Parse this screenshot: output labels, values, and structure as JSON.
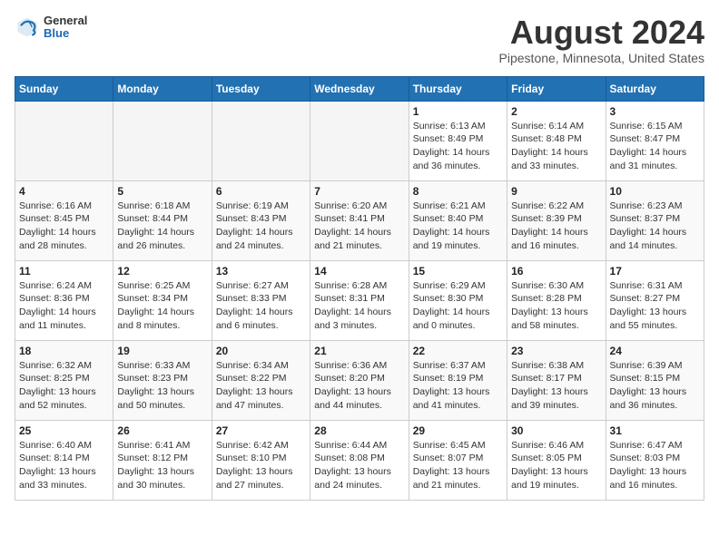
{
  "header": {
    "logo_general": "General",
    "logo_blue": "Blue",
    "month_title": "August 2024",
    "location": "Pipestone, Minnesota, United States"
  },
  "days_of_week": [
    "Sunday",
    "Monday",
    "Tuesday",
    "Wednesday",
    "Thursday",
    "Friday",
    "Saturday"
  ],
  "weeks": [
    [
      {
        "day": "",
        "info": ""
      },
      {
        "day": "",
        "info": ""
      },
      {
        "day": "",
        "info": ""
      },
      {
        "day": "",
        "info": ""
      },
      {
        "day": "1",
        "info": "Sunrise: 6:13 AM\nSunset: 8:49 PM\nDaylight: 14 hours\nand 36 minutes."
      },
      {
        "day": "2",
        "info": "Sunrise: 6:14 AM\nSunset: 8:48 PM\nDaylight: 14 hours\nand 33 minutes."
      },
      {
        "day": "3",
        "info": "Sunrise: 6:15 AM\nSunset: 8:47 PM\nDaylight: 14 hours\nand 31 minutes."
      }
    ],
    [
      {
        "day": "4",
        "info": "Sunrise: 6:16 AM\nSunset: 8:45 PM\nDaylight: 14 hours\nand 28 minutes."
      },
      {
        "day": "5",
        "info": "Sunrise: 6:18 AM\nSunset: 8:44 PM\nDaylight: 14 hours\nand 26 minutes."
      },
      {
        "day": "6",
        "info": "Sunrise: 6:19 AM\nSunset: 8:43 PM\nDaylight: 14 hours\nand 24 minutes."
      },
      {
        "day": "7",
        "info": "Sunrise: 6:20 AM\nSunset: 8:41 PM\nDaylight: 14 hours\nand 21 minutes."
      },
      {
        "day": "8",
        "info": "Sunrise: 6:21 AM\nSunset: 8:40 PM\nDaylight: 14 hours\nand 19 minutes."
      },
      {
        "day": "9",
        "info": "Sunrise: 6:22 AM\nSunset: 8:39 PM\nDaylight: 14 hours\nand 16 minutes."
      },
      {
        "day": "10",
        "info": "Sunrise: 6:23 AM\nSunset: 8:37 PM\nDaylight: 14 hours\nand 14 minutes."
      }
    ],
    [
      {
        "day": "11",
        "info": "Sunrise: 6:24 AM\nSunset: 8:36 PM\nDaylight: 14 hours\nand 11 minutes."
      },
      {
        "day": "12",
        "info": "Sunrise: 6:25 AM\nSunset: 8:34 PM\nDaylight: 14 hours\nand 8 minutes."
      },
      {
        "day": "13",
        "info": "Sunrise: 6:27 AM\nSunset: 8:33 PM\nDaylight: 14 hours\nand 6 minutes."
      },
      {
        "day": "14",
        "info": "Sunrise: 6:28 AM\nSunset: 8:31 PM\nDaylight: 14 hours\nand 3 minutes."
      },
      {
        "day": "15",
        "info": "Sunrise: 6:29 AM\nSunset: 8:30 PM\nDaylight: 14 hours\nand 0 minutes."
      },
      {
        "day": "16",
        "info": "Sunrise: 6:30 AM\nSunset: 8:28 PM\nDaylight: 13 hours\nand 58 minutes."
      },
      {
        "day": "17",
        "info": "Sunrise: 6:31 AM\nSunset: 8:27 PM\nDaylight: 13 hours\nand 55 minutes."
      }
    ],
    [
      {
        "day": "18",
        "info": "Sunrise: 6:32 AM\nSunset: 8:25 PM\nDaylight: 13 hours\nand 52 minutes."
      },
      {
        "day": "19",
        "info": "Sunrise: 6:33 AM\nSunset: 8:23 PM\nDaylight: 13 hours\nand 50 minutes."
      },
      {
        "day": "20",
        "info": "Sunrise: 6:34 AM\nSunset: 8:22 PM\nDaylight: 13 hours\nand 47 minutes."
      },
      {
        "day": "21",
        "info": "Sunrise: 6:36 AM\nSunset: 8:20 PM\nDaylight: 13 hours\nand 44 minutes."
      },
      {
        "day": "22",
        "info": "Sunrise: 6:37 AM\nSunset: 8:19 PM\nDaylight: 13 hours\nand 41 minutes."
      },
      {
        "day": "23",
        "info": "Sunrise: 6:38 AM\nSunset: 8:17 PM\nDaylight: 13 hours\nand 39 minutes."
      },
      {
        "day": "24",
        "info": "Sunrise: 6:39 AM\nSunset: 8:15 PM\nDaylight: 13 hours\nand 36 minutes."
      }
    ],
    [
      {
        "day": "25",
        "info": "Sunrise: 6:40 AM\nSunset: 8:14 PM\nDaylight: 13 hours\nand 33 minutes."
      },
      {
        "day": "26",
        "info": "Sunrise: 6:41 AM\nSunset: 8:12 PM\nDaylight: 13 hours\nand 30 minutes."
      },
      {
        "day": "27",
        "info": "Sunrise: 6:42 AM\nSunset: 8:10 PM\nDaylight: 13 hours\nand 27 minutes."
      },
      {
        "day": "28",
        "info": "Sunrise: 6:44 AM\nSunset: 8:08 PM\nDaylight: 13 hours\nand 24 minutes."
      },
      {
        "day": "29",
        "info": "Sunrise: 6:45 AM\nSunset: 8:07 PM\nDaylight: 13 hours\nand 21 minutes."
      },
      {
        "day": "30",
        "info": "Sunrise: 6:46 AM\nSunset: 8:05 PM\nDaylight: 13 hours\nand 19 minutes."
      },
      {
        "day": "31",
        "info": "Sunrise: 6:47 AM\nSunset: 8:03 PM\nDaylight: 13 hours\nand 16 minutes."
      }
    ]
  ]
}
